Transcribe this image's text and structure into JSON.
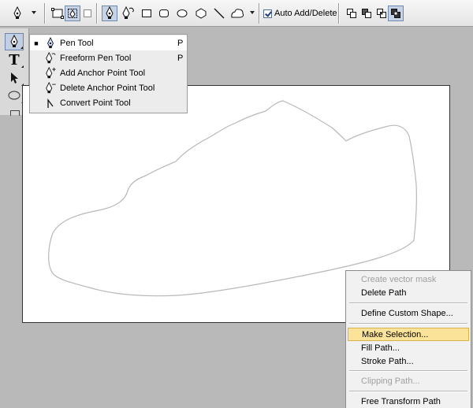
{
  "options_bar": {
    "auto_add_delete": {
      "label": "Auto Add/Delete",
      "checked": true
    },
    "icons": [
      "pen-tool-preset-icon",
      "shape-layers-icon",
      "paths-icon",
      "fill-pixels-icon",
      "pen-icon",
      "freeform-pen-icon",
      "rectangle-icon",
      "rounded-rectangle-icon",
      "ellipse-icon",
      "polygon-icon",
      "line-icon",
      "custom-shape-icon",
      "add-to-path-area-icon",
      "subtract-from-path-area-icon",
      "intersect-path-areas-icon",
      "exclude-overlapping-path-areas-icon"
    ]
  },
  "toolbox": {
    "tools": [
      "pen-tool-icon",
      "type-tool-icon",
      "path-selection-tool-icon",
      "ellipse-tool-icon"
    ]
  },
  "flyout": {
    "items": [
      {
        "label": "Pen Tool",
        "shortcut": "P",
        "selected": true
      },
      {
        "label": "Freeform Pen Tool",
        "shortcut": "P",
        "selected": false
      },
      {
        "label": "Add Anchor Point Tool",
        "shortcut": "",
        "selected": false
      },
      {
        "label": "Delete Anchor Point Tool",
        "shortcut": "",
        "selected": false
      },
      {
        "label": "Convert Point Tool",
        "shortcut": "",
        "selected": false
      }
    ]
  },
  "context_menu": {
    "items": [
      {
        "label": "Create vector mask",
        "enabled": false
      },
      {
        "label": "Delete Path",
        "enabled": true
      },
      {
        "label": "Define Custom Shape...",
        "enabled": true
      },
      {
        "label": "Make Selection...",
        "enabled": true,
        "highlighted": true
      },
      {
        "label": "Fill Path...",
        "enabled": true
      },
      {
        "label": "Stroke Path...",
        "enabled": true
      },
      {
        "label": "Clipping Path...",
        "enabled": false
      },
      {
        "label": "Free Transform Path",
        "enabled": true
      }
    ]
  },
  "colors": {
    "workspace": "#b9b9b9",
    "menu_highlight": "#fbe49a",
    "pressed_button": "#c7d3e6",
    "path_stroke": "#b8b8b8"
  }
}
